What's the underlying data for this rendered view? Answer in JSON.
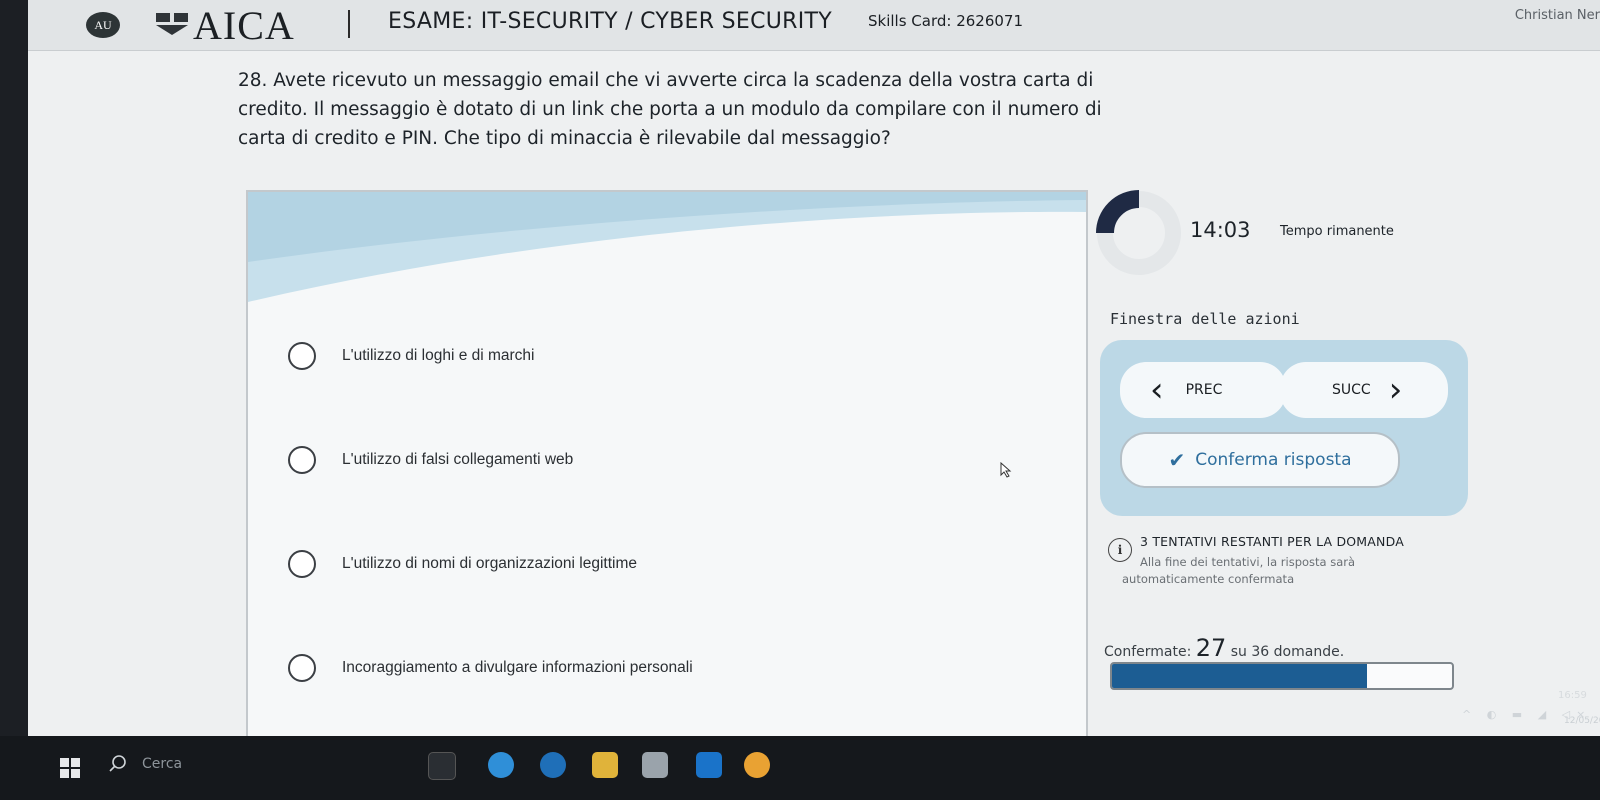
{
  "header": {
    "badge_text": "AU",
    "logo_text": "AICA",
    "exam_title": "ESAME: IT-SECURITY / CYBER SECURITY",
    "skills_card": "Skills Card: 2626071",
    "user_name": "Christian Ner"
  },
  "question": {
    "text": "28. Avete ricevuto un messaggio email che vi avverte circa la scadenza della vostra carta di credito. Il messaggio è dotato di un link che porta a un modulo da compilare con il numero di carta di credito e PIN. Che tipo di minaccia è rilevabile dal messaggio?"
  },
  "answers": [
    {
      "label": "L'utilizzo di loghi e di marchi"
    },
    {
      "label": "L'utilizzo di falsi collegamenti web"
    },
    {
      "label": "L'utilizzo di nomi di organizzazioni legittime"
    },
    {
      "label": "Incoraggiamento a divulgare informazioni personali"
    }
  ],
  "timer": {
    "value": "14:03",
    "label": "Tempo rimanente"
  },
  "actions": {
    "title": "Finestra delle azioni",
    "prev_label": "PREC",
    "next_label": "SUCC",
    "confirm_label": "Conferma risposta"
  },
  "attempts": {
    "icon": "info-icon",
    "title": "3 TENTATIVI RESTANTI PER LA DOMANDA",
    "note": "Alla fine dei tentativi, la risposta sarà automaticamente confermata"
  },
  "progress": {
    "prefix": "Confermate:",
    "confirmed": "27",
    "suffix": "su 36 domande.",
    "fraction": 0.75
  },
  "taskbar": {
    "search_label": "Cerca",
    "time": "16:59",
    "date": "12/05/20"
  },
  "colors": {
    "accent": "#1c5d93",
    "panel_blue": "#bcd8e6",
    "confirm_text": "#2f6f9d"
  }
}
